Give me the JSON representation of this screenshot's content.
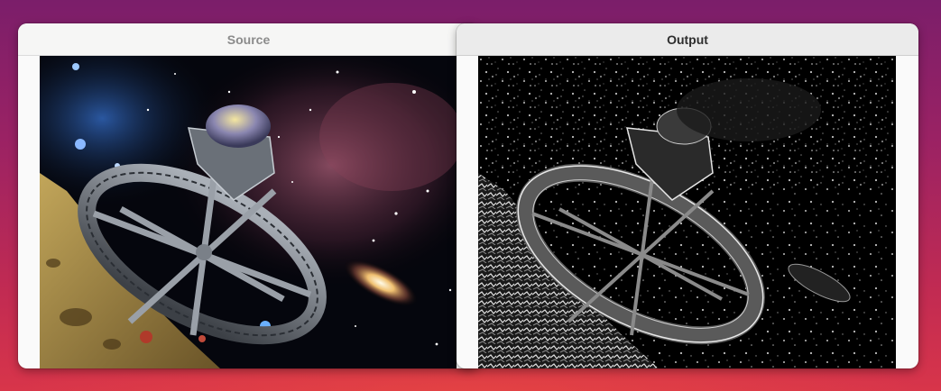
{
  "desktop": {
    "background": "#b0255a"
  },
  "windows": {
    "source": {
      "title": "Source",
      "active": false
    },
    "output": {
      "title": "Output",
      "active": true
    }
  },
  "images": {
    "source": {
      "description_icon": "space-station-image",
      "dominant_colors": [
        "#0a0d1a",
        "#9a7a3a",
        "#8a5a6a",
        "#5aa0ff"
      ]
    },
    "output": {
      "description_icon": "emboss-filter-image",
      "dominant_colors": [
        "#000000",
        "#ffffff",
        "#6a6a6a"
      ]
    }
  }
}
